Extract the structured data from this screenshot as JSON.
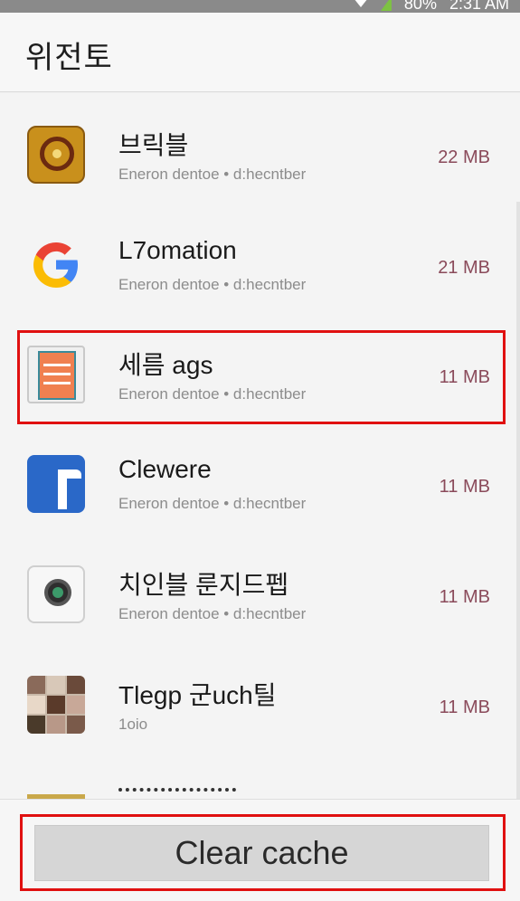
{
  "status_bar": {
    "battery": "80%",
    "time": "2:31 AM"
  },
  "header": {
    "title": "위전토"
  },
  "apps": [
    {
      "name": "브릭블",
      "subtitle": "Eneron dentoe • d:hecntber",
      "size": "22 MB",
      "icon": "gold-emblem-icon",
      "highlighted": false
    },
    {
      "name": "L7omation",
      "subtitle": "Eneron dentoe • d:hecntber",
      "size": "21 MB",
      "icon": "google-g-icon",
      "highlighted": false
    },
    {
      "name": "세름 ags",
      "subtitle": "Eneron dentoe • d:hecntber",
      "size": "11 MB",
      "icon": "document-page-icon",
      "highlighted": true
    },
    {
      "name": "Clewere",
      "subtitle": "Eneron dentoe • d:hecntber",
      "size": "11 MB",
      "icon": "blue-f-icon",
      "highlighted": false
    },
    {
      "name": "치인블 룬지드펩",
      "subtitle": "Eneron dentoe • d:hecntber",
      "size": "11 MB",
      "icon": "camera-icon",
      "highlighted": false
    },
    {
      "name": "Tlegp 군uch틸",
      "subtitle": "1oio",
      "size": "11 MB",
      "icon": "photo-grid-icon",
      "highlighted": false
    }
  ],
  "footer": {
    "clear_cache_label": "Clear cache"
  },
  "colors": {
    "highlight": "#e01010",
    "size_text": "#8a4a5a",
    "accent_blue": "#2a68c8"
  }
}
